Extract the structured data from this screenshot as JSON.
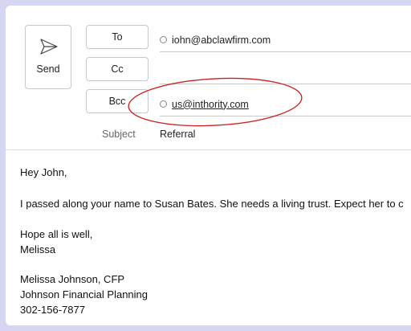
{
  "compose": {
    "send_label": "Send",
    "to_label": "To",
    "cc_label": "Cc",
    "bcc_label": "Bcc",
    "to_value": "iohn@abclawfirm.com",
    "cc_value": "",
    "bcc_value": "us@inthority.com",
    "subject_label": "Subject",
    "subject_value": "Referral"
  },
  "body": {
    "greeting": "Hey John,",
    "line1": "I passed along your name to Susan Bates. She needs a living trust. Expect her to c",
    "closing1": "Hope all is well,",
    "closing2": "Melissa",
    "sig_name": "Melissa Johnson, CFP",
    "sig_company": "Johnson Financial Planning",
    "sig_phone": "302-156-7877"
  },
  "annotation": {
    "color": "#cc1f1f"
  }
}
